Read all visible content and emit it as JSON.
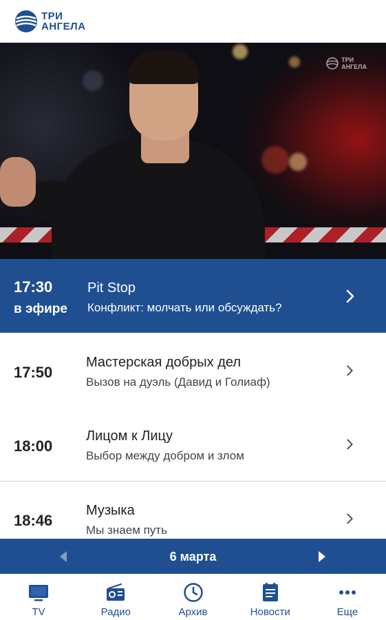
{
  "header": {
    "logo_line1": "ТРИ",
    "logo_line2": "АНГЕЛА"
  },
  "video": {
    "watermark_line1": "ТРИ",
    "watermark_line2": "АНГЕЛА"
  },
  "now_playing": {
    "time": "17:30",
    "status": "в эфире",
    "title": "Pit Stop",
    "subtitle": "Конфликт: молчать или обсуждать?"
  },
  "schedule": [
    {
      "time": "17:50",
      "title": "Мастерская добрых дел",
      "subtitle": "Вызов на дуэль (Давид и Голиаф)"
    },
    {
      "time": "18:00",
      "title": "Лицом к Лицу",
      "subtitle": "Выбор между добром и злом"
    },
    {
      "time": "18:46",
      "title": "Музыка",
      "subtitle": "Мы знаем путь"
    }
  ],
  "date_bar": {
    "label": "6 марта"
  },
  "nav": [
    {
      "label": "TV",
      "icon": "tv-icon"
    },
    {
      "label": "Радио",
      "icon": "radio-icon"
    },
    {
      "label": "Архив",
      "icon": "clock-icon"
    },
    {
      "label": "Новости",
      "icon": "news-icon"
    },
    {
      "label": "Еще",
      "icon": "more-icon"
    }
  ],
  "colors": {
    "brand": "#1f4f91",
    "nav_active": "#1f4f91",
    "text": "#222222"
  }
}
